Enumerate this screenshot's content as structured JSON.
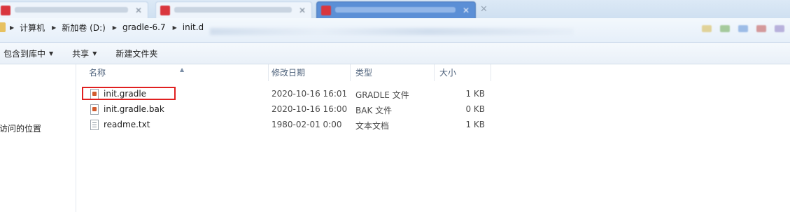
{
  "browser_tabs": [
    {
      "active": false
    },
    {
      "active": false
    },
    {
      "active": true
    }
  ],
  "breadcrumb": [
    "计算机",
    "新加卷 (D:)",
    "gradle-6.7",
    "init.d"
  ],
  "toolbar": {
    "include_library": "包含到库中",
    "share": "共享",
    "new_folder": "新建文件夹"
  },
  "nav": {
    "recent_places": "访问的位置"
  },
  "columns": {
    "name": "名称",
    "date": "修改日期",
    "type": "类型",
    "size": "大小"
  },
  "files": [
    {
      "name": "init.gradle",
      "date": "2020-10-16 16:01",
      "type": "GRADLE 文件",
      "size": "1 KB",
      "icon": "gradle-file-icon",
      "highlighted": true
    },
    {
      "name": "init.gradle.bak",
      "date": "2020-10-16 16:00",
      "type": "BAK 文件",
      "size": "0 KB",
      "icon": "gradle-file-icon"
    },
    {
      "name": "readme.txt",
      "date": "1980-02-01 0:00",
      "type": "文本文档",
      "size": "1 KB",
      "icon": "text-file-icon"
    }
  ],
  "colors": {
    "highlight_box": "#e02020",
    "gradle_icon_mark": "#d25b2e"
  }
}
